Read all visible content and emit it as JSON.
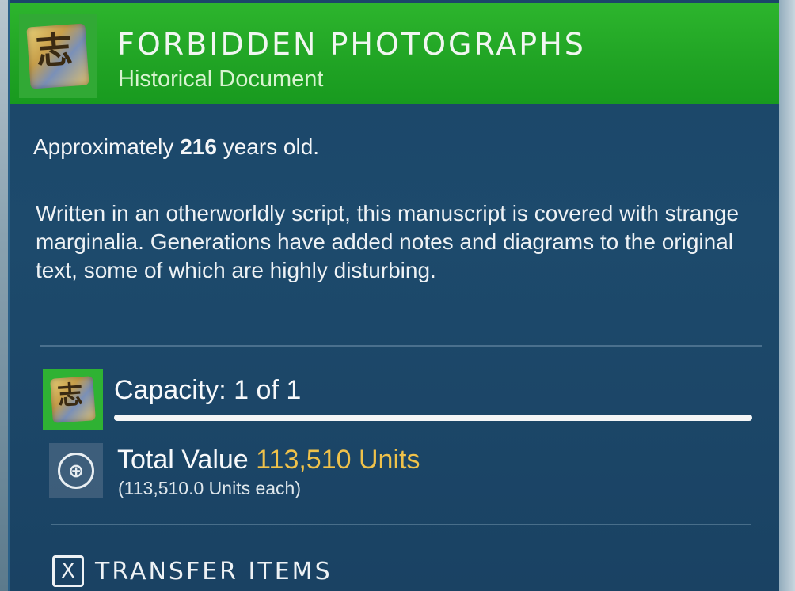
{
  "item": {
    "name": "FORBIDDEN PHOTOGRAPHS",
    "type": "Historical Document",
    "icon": "document-icon",
    "age_prefix": "Approximately",
    "age_value": "216",
    "age_suffix": "years old.",
    "description": "Written in an otherworldly script, this manuscript is covered with strange marginalia. Generations have added notes and diagrams to the original text, some of which are highly disturbing."
  },
  "capacity": {
    "label": "Capacity: 1 of 1",
    "fill_fraction": 1.0
  },
  "value": {
    "label": "Total Value",
    "amount": "113,510 Units",
    "each": "(113,510.0 Units each)",
    "icon": "units-currency-icon"
  },
  "actions": {
    "transfer_key": "X",
    "transfer_label": "TRANSFER ITEMS"
  },
  "colors": {
    "header_green": "#20a324",
    "panel_blue": "#1b4669",
    "value_gold": "#f0c24a"
  }
}
